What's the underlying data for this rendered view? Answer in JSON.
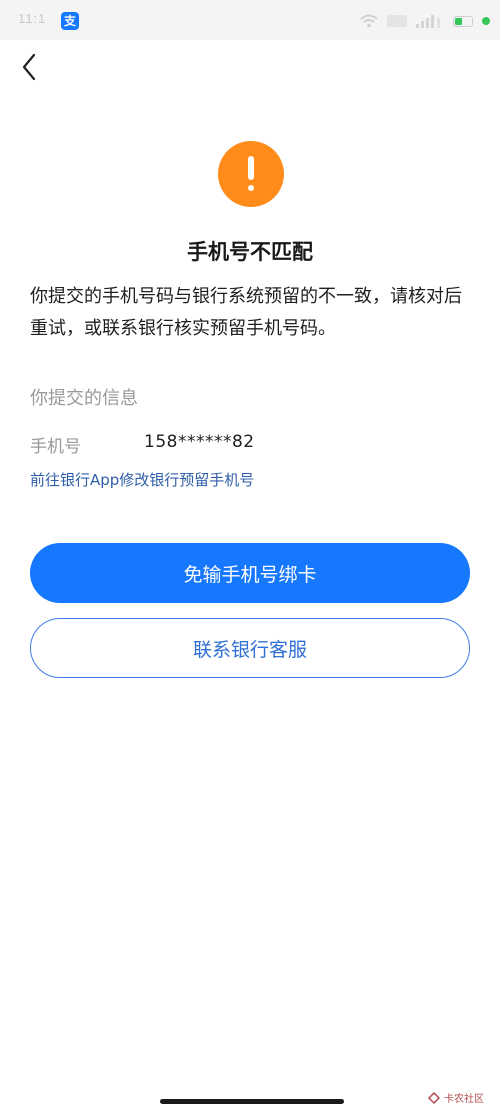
{
  "status_bar": {
    "time": "11:1"
  },
  "header": {
    "back_icon": "chevron-left-icon"
  },
  "result": {
    "icon": "exclamation-icon",
    "icon_color": "#ff8c1a",
    "title": "手机号不匹配",
    "message": "你提交的手机号码与银行系统预留的不一致，请核对后重试，或联系银行核实预留手机号码。"
  },
  "info": {
    "section_title": "你提交的信息",
    "phone_label": "手机号",
    "phone_value": "158******82",
    "modify_link": "前往银行App修改银行预留手机号"
  },
  "actions": {
    "primary_label": "免输手机号绑卡",
    "primary_color": "#1677ff",
    "secondary_label": "联系银行客服"
  },
  "watermark": {
    "text": "卡农社区"
  }
}
